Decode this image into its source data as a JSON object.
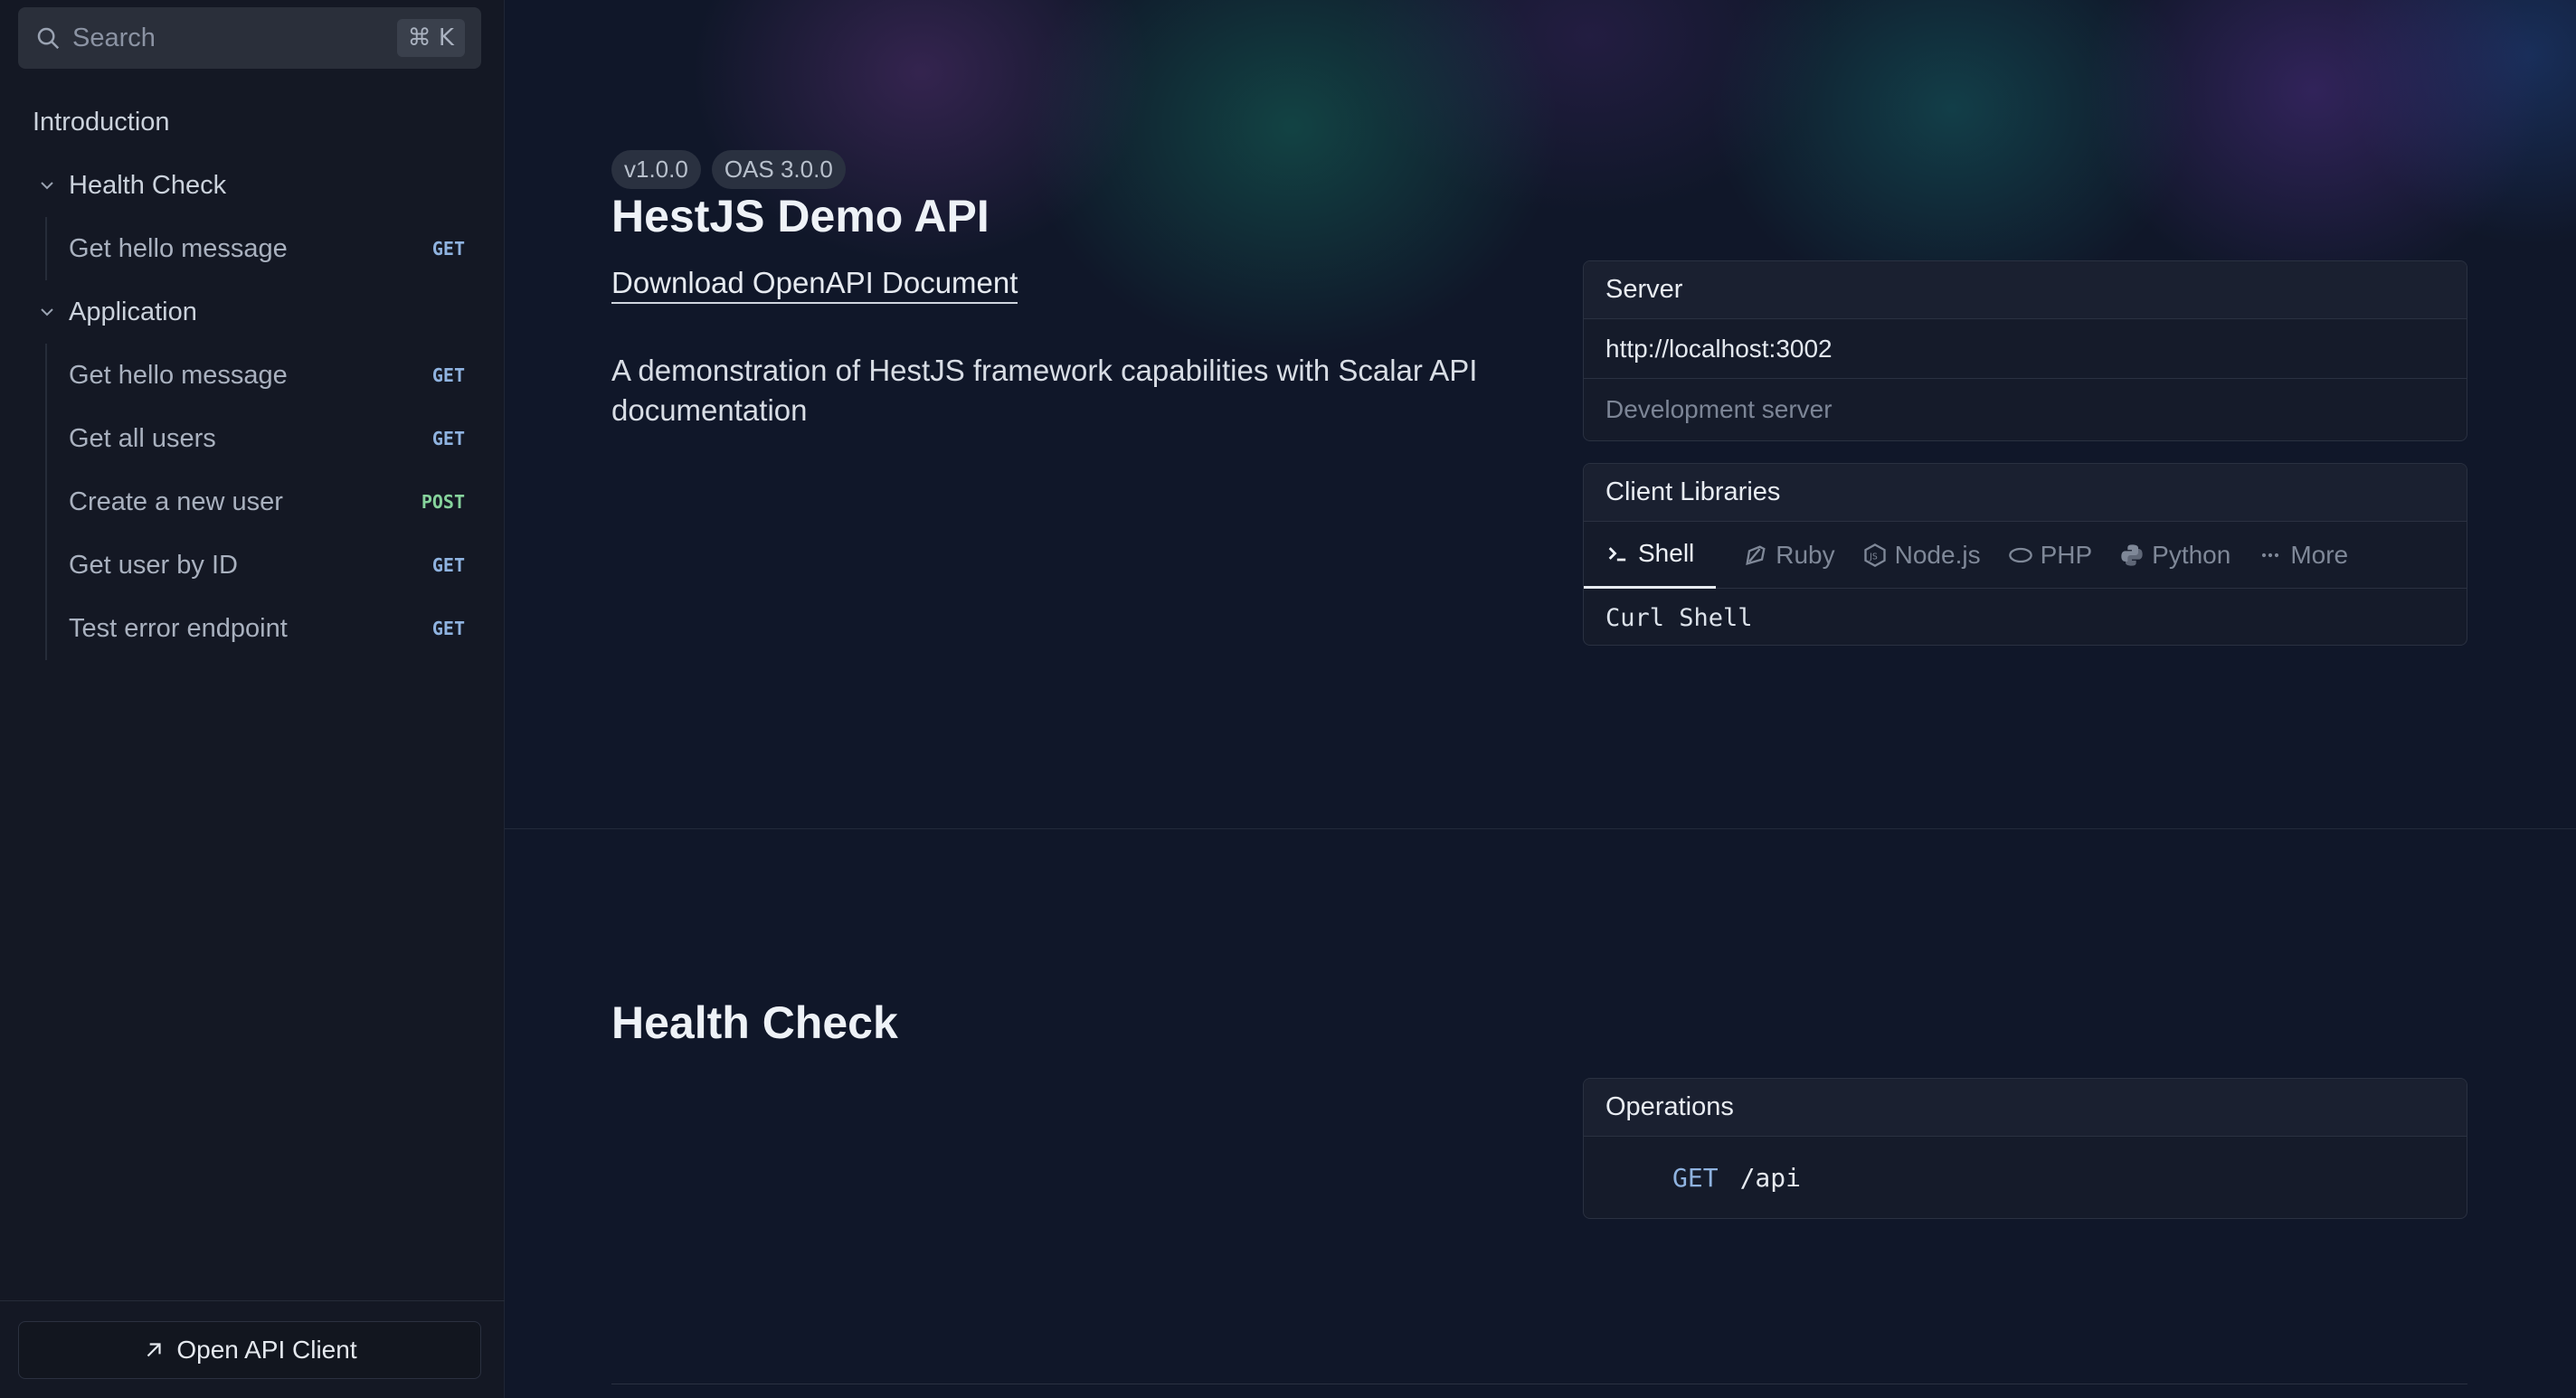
{
  "sidebar": {
    "search": {
      "placeholder": "Search",
      "shortcut": "⌘ K"
    },
    "introduction": "Introduction",
    "groups": [
      {
        "label": "Health Check",
        "items": [
          {
            "label": "Get hello message",
            "method": "GET"
          }
        ]
      },
      {
        "label": "Application",
        "items": [
          {
            "label": "Get hello message",
            "method": "GET"
          },
          {
            "label": "Get all users",
            "method": "GET"
          },
          {
            "label": "Create a new user",
            "method": "POST"
          },
          {
            "label": "Get user by ID",
            "method": "GET"
          },
          {
            "label": "Test error endpoint",
            "method": "GET"
          }
        ]
      }
    ],
    "footer_button": "Open API Client"
  },
  "main": {
    "badges": [
      "v1.0.0",
      "OAS 3.0.0"
    ],
    "title": "HestJS Demo API",
    "download_link": "Download OpenAPI Document",
    "description": "A demonstration of HestJS framework capabilities with Scalar API documentation",
    "server": {
      "heading": "Server",
      "url": "http://localhost:3002",
      "description": "Development server"
    },
    "client_libraries": {
      "heading": "Client Libraries",
      "tabs": [
        "Shell",
        "Ruby",
        "Node.js",
        "PHP",
        "Python",
        "More"
      ],
      "selected": "Curl Shell"
    },
    "section": {
      "title": "Health Check",
      "operations_heading": "Operations",
      "operation": {
        "method": "GET",
        "path": "/api"
      }
    }
  }
}
